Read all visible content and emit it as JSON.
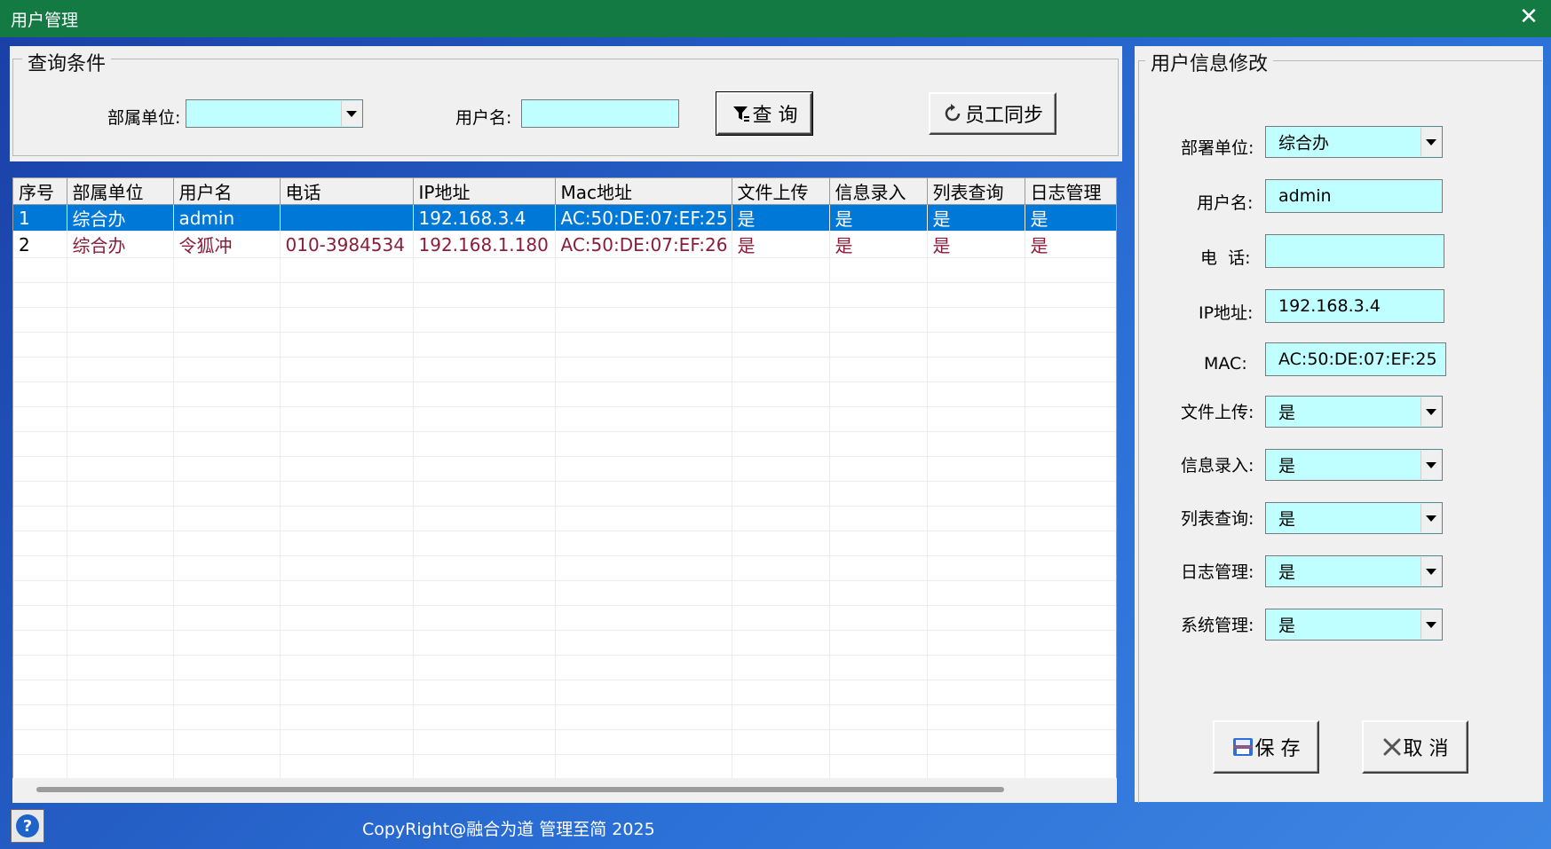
{
  "window": {
    "title": "用户管理",
    "close_glyph": "✕"
  },
  "query": {
    "group_title": "查询条件",
    "dept_label": "部属单位:",
    "dept_value": "",
    "username_label": "用户名:",
    "username_value": "",
    "search_button": "查 询",
    "sync_button": "员工同步"
  },
  "grid": {
    "columns": [
      "序号",
      "部属单位",
      "用户名",
      "电话",
      "IP地址",
      "Mac地址",
      "文件上传",
      "信息录入",
      "列表查询",
      "日志管理"
    ],
    "rows": [
      [
        "1",
        "综合办",
        "admin",
        "",
        "192.168.3.4",
        "AC:50:DE:07:EF:25",
        "是",
        "是",
        "是",
        "是"
      ],
      [
        "2",
        "综合办",
        "令狐冲",
        "010-3984534",
        "192.168.1.180",
        "AC:50:DE:07:EF:26",
        "是",
        "是",
        "是",
        "是"
      ]
    ],
    "selected_row": 0
  },
  "edit": {
    "group_title": "用户信息修改",
    "dept_label": "部署单位:",
    "dept_value": "综合办",
    "username_label": "用户名:",
    "username_value": "admin",
    "phone_label": "电  话:",
    "phone_value": "",
    "ip_label": "IP地址:",
    "ip_value": "192.168.3.4",
    "mac_label": "MAC:",
    "mac_value": "AC:50:DE:07:EF:25",
    "upload_label": "文件上传:",
    "upload_value": "是",
    "entry_label": "信息录入:",
    "entry_value": "是",
    "list_label": "列表查询:",
    "list_value": "是",
    "log_label": "日志管理:",
    "log_value": "是",
    "sys_label": "系统管理:",
    "sys_value": "是",
    "save_button": "保 存",
    "cancel_button": "取 消"
  },
  "footer": {
    "copyright": "CopyRight@融合为道 管理至简 2025",
    "help_glyph": "?"
  },
  "colors": {
    "titlebar": "#137a43",
    "input_bg": "#bfffff",
    "selection": "#0078d7",
    "row_text": "#8b1c3a"
  },
  "icons": [
    "close-icon",
    "filter-icon",
    "refresh-icon",
    "save-icon",
    "cancel-x-icon",
    "help-icon",
    "chevron-down-icon"
  ]
}
